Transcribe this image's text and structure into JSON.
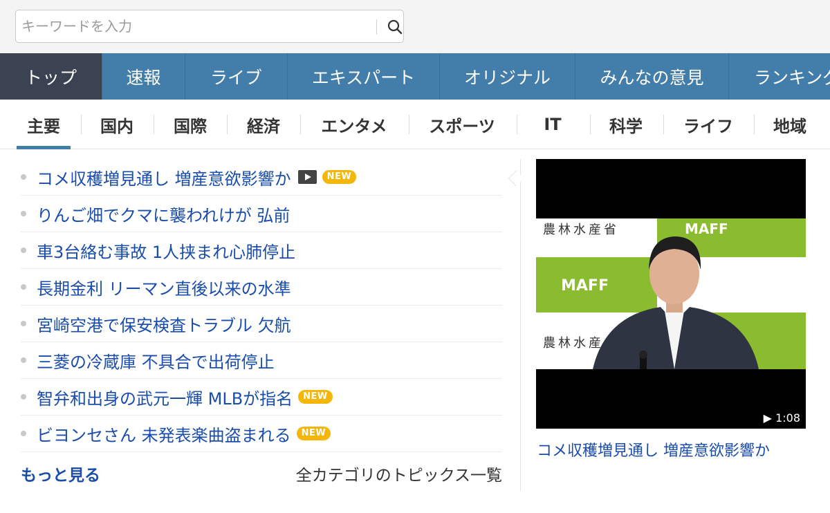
{
  "search": {
    "placeholder": "キーワードを入力",
    "value": ""
  },
  "main_nav": [
    {
      "label": "トップ",
      "active": true
    },
    {
      "label": "速報"
    },
    {
      "label": "ライブ"
    },
    {
      "label": "エキスパート"
    },
    {
      "label": "オリジナル"
    },
    {
      "label": "みんなの意見"
    },
    {
      "label": "ランキング"
    }
  ],
  "categories": [
    {
      "label": "主要",
      "active": true
    },
    {
      "label": "国内"
    },
    {
      "label": "国際"
    },
    {
      "label": "経済"
    },
    {
      "label": "エンタメ"
    },
    {
      "label": "スポーツ"
    },
    {
      "label": "IT"
    },
    {
      "label": "科学"
    },
    {
      "label": "ライフ"
    },
    {
      "label": "地域"
    }
  ],
  "topics": [
    {
      "title": "コメ収穫増見通し 増産意欲影響か",
      "video": true,
      "new": true
    },
    {
      "title": "りんご畑でクマに襲われけが 弘前",
      "video": false,
      "new": false
    },
    {
      "title": "車3台絡む事故 1人挟まれ心肺停止",
      "video": false,
      "new": false
    },
    {
      "title": "長期金利 リーマン直後以来の水準",
      "video": false,
      "new": false
    },
    {
      "title": "宮崎空港で保安検査トラブル 欠航",
      "video": false,
      "new": false
    },
    {
      "title": "三菱の冷蔵庫 不具合で出荷停止",
      "video": false,
      "new": false
    },
    {
      "title": "智弁和出身の武元一輝 MLBが指名",
      "video": false,
      "new": true
    },
    {
      "title": "ビヨンセさん 未発表楽曲盗まれる",
      "video": false,
      "new": true
    }
  ],
  "badges": {
    "new_label": "NEW"
  },
  "more_label": "もっと見る",
  "all_topics_label": "全カテゴリのトピックス一覧",
  "video": {
    "backdrop_text_1": "農林水産省",
    "backdrop_logo": "MAFF",
    "duration": "▶ 1:08",
    "caption": "コメ収穫増見通し 増産意欲影響か"
  },
  "colors": {
    "nav": "#427ea9",
    "nav_active": "#3b4252",
    "link": "#1a4dab",
    "new_badge": "#f5b60a"
  }
}
